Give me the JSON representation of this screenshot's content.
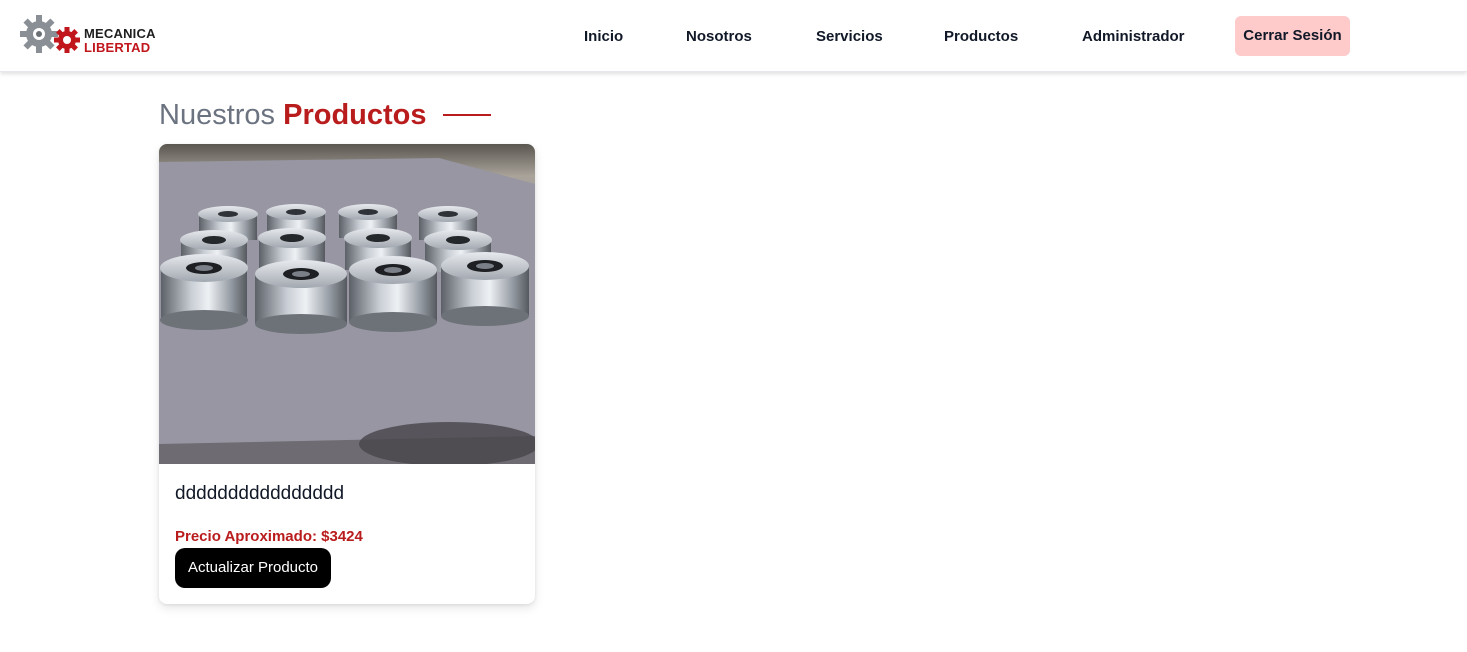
{
  "brand": {
    "line1": "MECANICA",
    "line2": "LIBERTAD",
    "gear_icon": "gear-icon",
    "accent_color": "#c0161c"
  },
  "nav": {
    "items": [
      {
        "label": "Inicio"
      },
      {
        "label": "Nosotros"
      },
      {
        "label": "Servicios"
      },
      {
        "label": "Productos"
      },
      {
        "label": "Administrador"
      }
    ],
    "logout_label": "Cerrar Sesión",
    "logout_bg": "#fecaca"
  },
  "heading": {
    "light": "Nuestros",
    "accent": "Productos",
    "accent_color": "#b91c1c"
  },
  "products": [
    {
      "name": "dddddddddddddddd",
      "price_label": "Precio Aproximado: $3424",
      "button_label": "Actualizar Producto",
      "image_icon": "product-photo-pulleys"
    }
  ]
}
